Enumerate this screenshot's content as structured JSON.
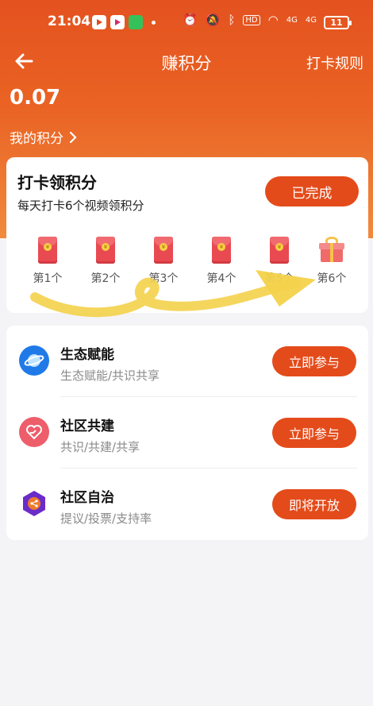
{
  "status_bar": {
    "time": "21:04",
    "battery": "11",
    "network_labels": [
      "4G",
      "4G"
    ],
    "hd_label": "HD"
  },
  "header": {
    "title": "赚积分",
    "rules_link": "打卡规则"
  },
  "points": {
    "value": "0.07",
    "label": "我的积分"
  },
  "checkin": {
    "title": "打卡领积分",
    "subtitle": "每天打卡6个视频领积分",
    "button_label": "已完成",
    "days": [
      {
        "label": "第1个",
        "icon": "red-envelope-icon"
      },
      {
        "label": "第2个",
        "icon": "red-envelope-icon"
      },
      {
        "label": "第3个",
        "icon": "red-envelope-icon"
      },
      {
        "label": "第4个",
        "icon": "red-envelope-icon"
      },
      {
        "label": "第5个",
        "icon": "red-envelope-icon"
      },
      {
        "label": "第6个",
        "icon": "gift-box-icon"
      }
    ]
  },
  "tasks": [
    {
      "title": "生态赋能",
      "subtitle": "生态赋能/共识共享",
      "button": "立即参与",
      "icon": "planet-icon",
      "icon_color": "#1f7ae8"
    },
    {
      "title": "社区共建",
      "subtitle": "共识/共建/共享",
      "button": "立即参与",
      "icon": "heart-hands-icon",
      "icon_color": "#ee5d6a"
    },
    {
      "title": "社区自治",
      "subtitle": "提议/投票/支持率",
      "button": "即将开放",
      "icon": "share-hexagon-icon",
      "icon_color": "#6a2cc9"
    }
  ],
  "colors": {
    "brand": "#e4521f",
    "button": "#e44b1b",
    "annotation_arrow": "#f4d24b"
  }
}
